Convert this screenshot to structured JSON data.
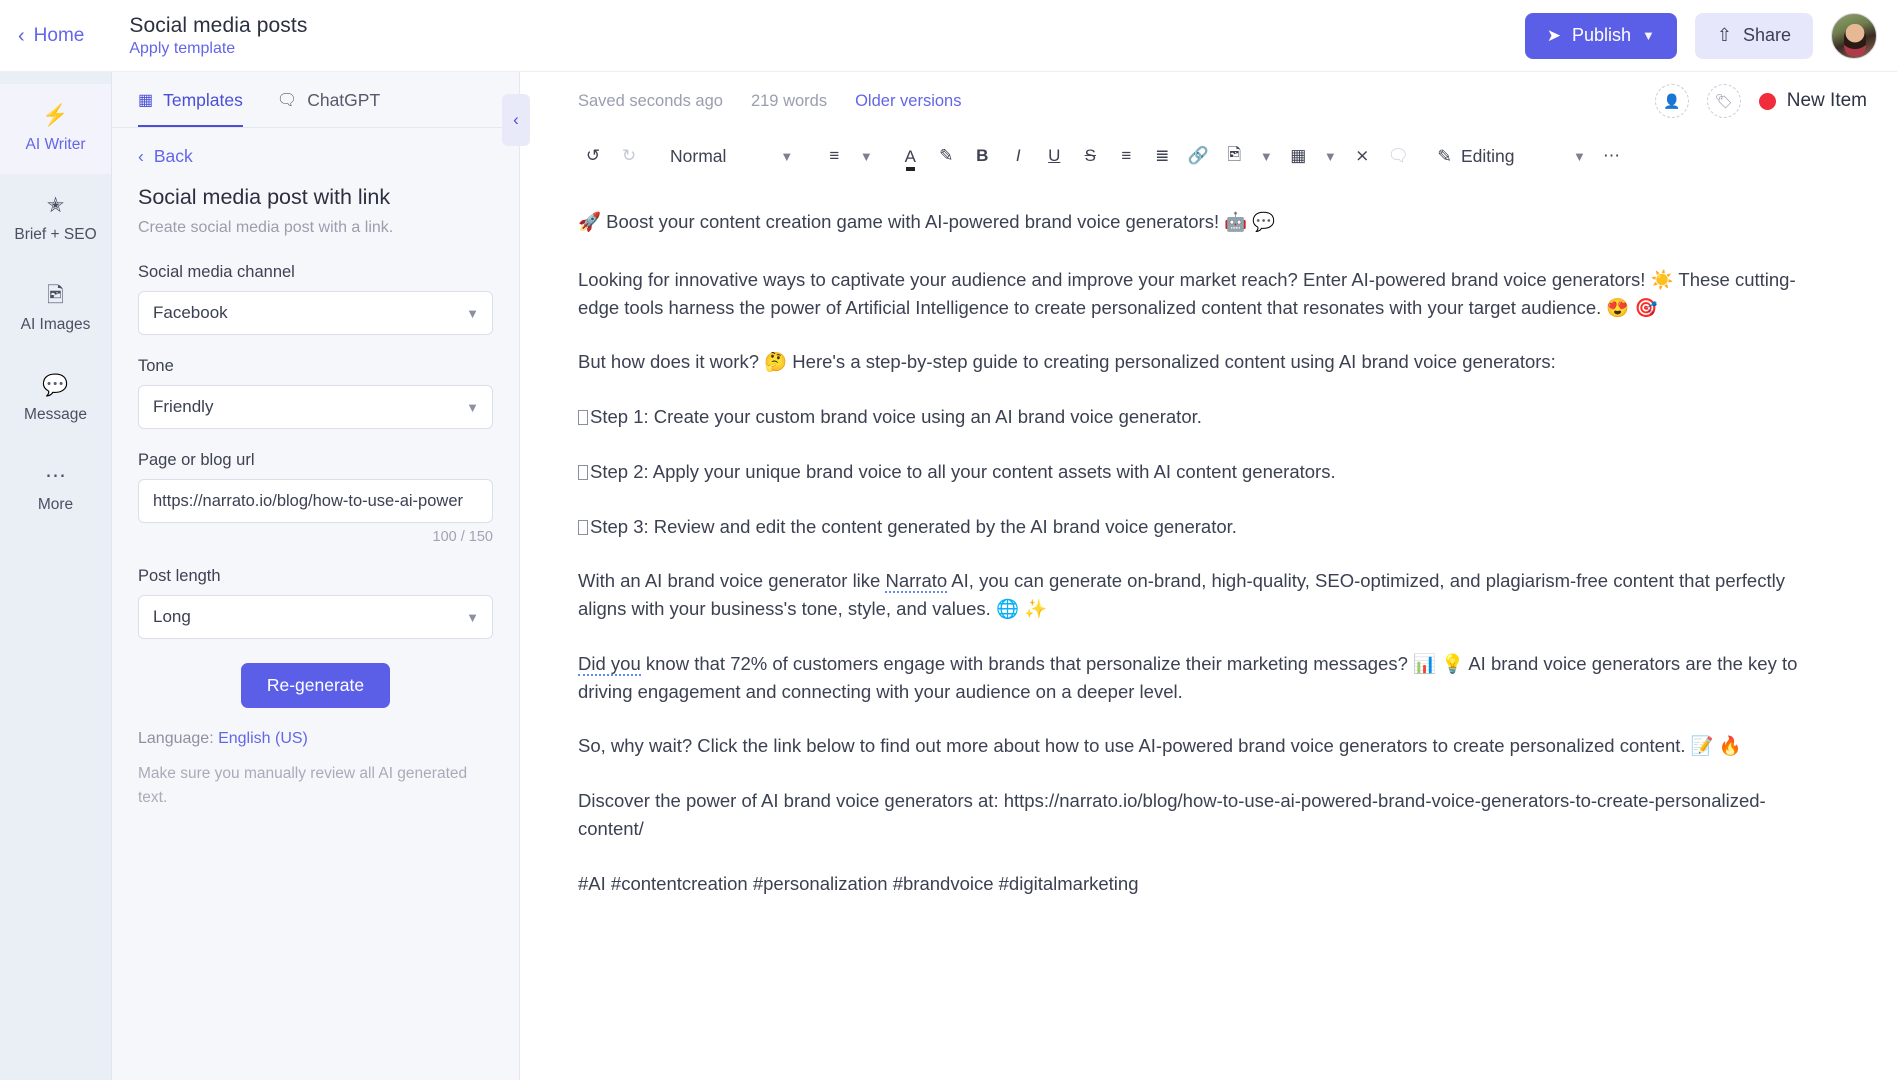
{
  "topbar": {
    "home_label": "Home",
    "back_icon": "chevron-left-icon",
    "doc_title": "Social media posts",
    "apply_template": "Apply template",
    "publish_label": "Publish",
    "publish_icon": "send-icon",
    "publish_chevron": "chevron-down-icon",
    "share_label": "Share",
    "share_icon": "share-upload-icon",
    "avatar": "user-avatar",
    "accent_color": "#5b5fe8",
    "link_color": "#6366e8"
  },
  "rail": {
    "items": [
      {
        "label": "AI Writer",
        "icon": "lightning-icon",
        "active": true
      },
      {
        "label": "Brief + SEO",
        "icon": "target-icon",
        "active": false
      },
      {
        "label": "AI Images",
        "icon": "image-icon",
        "active": false
      },
      {
        "label": "Message",
        "icon": "chat-icon",
        "active": false
      },
      {
        "label": "More",
        "icon": "ellipsis-icon",
        "active": false
      }
    ]
  },
  "panel": {
    "tabs": [
      {
        "label": "Templates",
        "icon": "templates-grid-icon",
        "active": true
      },
      {
        "label": "ChatGPT",
        "icon": "chat-bubbles-icon",
        "active": false
      }
    ],
    "back_label": "Back",
    "back_icon": "chevron-left-icon",
    "template_name": "Social media post with link",
    "template_desc": "Create social media post with a link.",
    "fields": [
      {
        "label": "Social media channel",
        "type": "select",
        "value": "Facebook"
      },
      {
        "label": "Tone",
        "type": "select",
        "value": "Friendly"
      },
      {
        "label": "Page or blog url",
        "type": "text",
        "value": "https://narrato.io/blog/how-to-use-ai-power",
        "counter": "100 / 150"
      },
      {
        "label": "Post length",
        "type": "select",
        "value": "Long"
      }
    ],
    "regenerate_label": "Re-generate",
    "language_prefix": "Language: ",
    "language_value": "English (US)",
    "disclaimer": "Make sure you manually review all AI generated text.",
    "collapse_icon": "chevron-left-icon"
  },
  "editor": {
    "saved_status": "Saved seconds ago",
    "word_count": "219 words",
    "older_versions": "Older versions",
    "assign_icon": "add-person-icon",
    "tag_icon": "add-tag-icon",
    "status_label": "New Item",
    "status_color": "#f02d3a",
    "toolbar": {
      "undo": "undo-icon",
      "redo": "redo-icon",
      "style_value": "Normal",
      "style_chevron": "chevron-down-icon",
      "align": "align-icon",
      "align_chevron": "chevron-down-icon",
      "text_color": "text-color-icon",
      "highlight": "highlighter-icon",
      "bold": "B",
      "italic": "I",
      "underline": "U",
      "strikethrough": "S",
      "bullet_list": "bullet-list-icon",
      "numbered_list": "numbered-list-icon",
      "link": "link-icon",
      "image": "image-icon",
      "image_chevron": "chevron-down-icon",
      "table": "table-icon",
      "table_chevron": "chevron-down-icon",
      "clear_format": "clear-format-icon",
      "comment": "comment-icon",
      "mode_icon": "pencil-icon",
      "mode_label": "Editing",
      "mode_chevron": "chevron-down-icon",
      "more": "ellipsis-icon"
    },
    "document": {
      "paragraphs": [
        {
          "id": "p1",
          "text": "🚀 Boost your content creation game with AI-powered brand voice generators! 🤖 💬"
        },
        {
          "id": "p2",
          "text": "Looking for innovative ways to captivate your audience and improve your market reach? Enter AI-powered brand voice generators! ☀️ These cutting-edge tools harness the power of Artificial Intelligence to create personalized content that resonates with your target audience. 😍 🎯"
        },
        {
          "id": "p3",
          "text": "But how does it work? 🤔 Here's a step-by-step guide to creating personalized content using AI brand voice generators:"
        },
        {
          "id": "p4",
          "prefix": "1",
          "text": "Step 1: Create your custom brand voice using an AI brand voice generator."
        },
        {
          "id": "p5",
          "prefix": "2",
          "text": "Step 2: Apply your unique brand voice to all your content assets with AI content generators."
        },
        {
          "id": "p6",
          "prefix": "3",
          "text": "Step 3: Review and edit the content generated by the AI brand voice generator."
        },
        {
          "id": "p7",
          "text_before": "With an AI brand voice generator like ",
          "misspelled": "Narrato",
          "text_after": " AI, you can generate on-brand, high-quality, SEO-optimized, and plagiarism-free content that perfectly aligns with your business's tone, style, and values. 🌐 ✨"
        },
        {
          "id": "p8",
          "misspelled": "Did you",
          "text_after": " know that 72% of customers engage with brands that personalize their marketing messages? 📊 💡 AI brand voice generators are the key to driving engagement and connecting with your audience on a deeper level."
        },
        {
          "id": "p9",
          "text": "So, why wait? Click the link below to find out more about how to use AI-powered brand voice generators to create personalized content. 📝 🔥"
        },
        {
          "id": "p10",
          "text": " Discover the power of AI brand voice generators at: https://narrato.io/blog/how-to-use-ai-powered-brand-voice-generators-to-create-personalized-content/"
        },
        {
          "id": "p11",
          "text": "#AI #contentcreation #personalization #brandvoice #digitalmarketing"
        }
      ]
    }
  }
}
